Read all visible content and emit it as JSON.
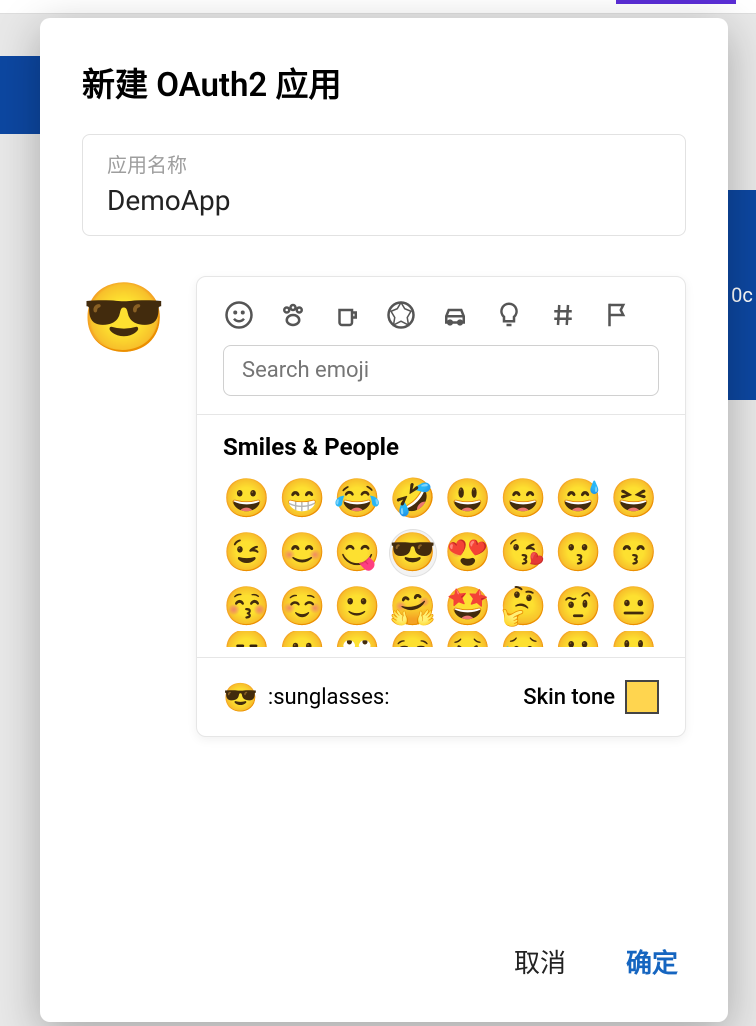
{
  "modal": {
    "title": "新建 OAuth2 应用",
    "field": {
      "label": "应用名称",
      "value": "DemoApp"
    },
    "selected_emoji": "😎",
    "actions": {
      "cancel": "取消",
      "confirm": "确定"
    }
  },
  "picker": {
    "search_placeholder": "Search emoji",
    "category_title": "Smiles & People",
    "tabs": [
      "smiley-icon",
      "paw-icon",
      "cup-icon",
      "soccer-icon",
      "car-icon",
      "bulb-icon",
      "hash-icon",
      "flag-icon"
    ],
    "grid": [
      [
        "😀",
        "😁",
        "😂",
        "🤣",
        "😃",
        "😄",
        "😅",
        "😆"
      ],
      [
        "😉",
        "😊",
        "😋",
        "😎",
        "😍",
        "😘",
        "😗",
        "😙"
      ],
      [
        "😚",
        "☺️",
        "🙂",
        "🤗",
        "🤩",
        "🤔",
        "🤨",
        "😐"
      ]
    ],
    "grid_partial": [
      "😑",
      "😶",
      "🙄",
      "😏",
      "😣",
      "😥",
      "😮",
      "🤐"
    ],
    "footer": {
      "preview_emoji": "😎",
      "shortcode": ":sunglasses:",
      "tone_label": "Skin tone"
    }
  },
  "backdrop": {
    "right_text": "0c"
  }
}
